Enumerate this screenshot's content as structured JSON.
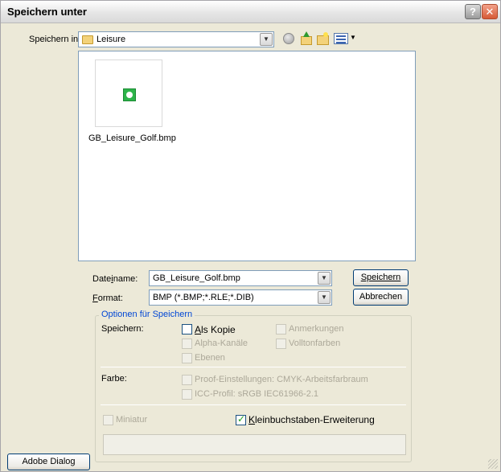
{
  "window": {
    "title": "Speichern unter"
  },
  "toolbar": {
    "save_in_label": "Speichern in:",
    "location": "Leisure"
  },
  "files": [
    {
      "name": "GB_Leisure_Golf.bmp"
    }
  ],
  "form": {
    "filename_label": "Dateiname:",
    "filename_value": "GB_Leisure_Golf.bmp",
    "format_label": "Format:",
    "format_value": "BMP (*.BMP;*.RLE;*.DIB)",
    "save_button": "Speichern",
    "cancel_button": "Abbrechen"
  },
  "options": {
    "group_title": "Optionen für Speichern",
    "save_label": "Speichern:",
    "als_kopie": "Als Kopie",
    "anmerkungen": "Anmerkungen",
    "alpha_kanaele": "Alpha-Kanäle",
    "volltonfarben": "Volltonfarben",
    "ebenen": "Ebenen",
    "farbe_label": "Farbe:",
    "proof": "Proof-Einstellungen: CMYK-Arbeitsfarbraum",
    "icc": "ICC-Profil: sRGB IEC61966-2.1",
    "miniatur": "Miniatur",
    "kleinbuchstaben": "Kleinbuchstaben-Erweiterung"
  },
  "footer": {
    "adobe_dialog": "Adobe Dialog"
  },
  "colors": {
    "accent": "#0046d5",
    "face": "#ece9d8",
    "border": "#7f9db9"
  }
}
